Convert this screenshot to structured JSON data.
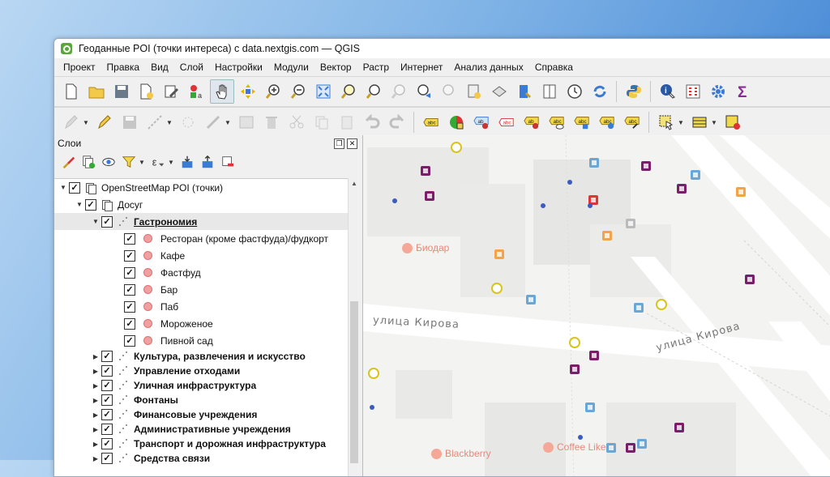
{
  "window": {
    "title": "Геоданные POI (точки интереса) с data.nextgis.com — QGIS"
  },
  "menu": [
    "Проект",
    "Правка",
    "Вид",
    "Слой",
    "Настройки",
    "Модули",
    "Вектор",
    "Растр",
    "Интернет",
    "Анализ данных",
    "Справка"
  ],
  "layers_panel": {
    "title": "Слои",
    "tree": [
      {
        "label": "OpenStreetMap POI (точки)",
        "level": 0,
        "type": "group",
        "expanded": true
      },
      {
        "label": "Досуг",
        "level": 1,
        "type": "group",
        "expanded": true
      },
      {
        "label": "Гастрономия",
        "level": 2,
        "type": "category",
        "expanded": true,
        "selected": true
      },
      {
        "label": "Ресторан (кроме фастфуда)/фудкорт",
        "level": 3,
        "type": "item"
      },
      {
        "label": "Кафе",
        "level": 3,
        "type": "item"
      },
      {
        "label": "Фастфуд",
        "level": 3,
        "type": "item"
      },
      {
        "label": "Бар",
        "level": 3,
        "type": "item"
      },
      {
        "label": "Паб",
        "level": 3,
        "type": "item"
      },
      {
        "label": "Мороженое",
        "level": 3,
        "type": "item"
      },
      {
        "label": "Пивной сад",
        "level": 3,
        "type": "item"
      },
      {
        "label": "Культура, развлечения и искусство",
        "level": 2,
        "type": "category"
      },
      {
        "label": "Управление отходами",
        "level": 2,
        "type": "category"
      },
      {
        "label": "Уличная инфраструктура",
        "level": 2,
        "type": "category"
      },
      {
        "label": "Фонтаны",
        "level": 2,
        "type": "category"
      },
      {
        "label": "Финансовые учреждения",
        "level": 2,
        "type": "category"
      },
      {
        "label": "Административные учреждения",
        "level": 2,
        "type": "category"
      },
      {
        "label": "Транспорт и дорожная инфраструктура",
        "level": 2,
        "type": "category"
      },
      {
        "label": "Средства связи",
        "level": 2,
        "type": "category"
      }
    ]
  },
  "map": {
    "street_label_1": "улица Кирова",
    "street_label_2": "улица Кирова",
    "poi_labels": [
      "Биодар",
      "Blackberry",
      "Coffee Like"
    ]
  },
  "colors": {
    "museum": "#7a1e6b",
    "service": "#6aa6d6",
    "shop": "#f2a44a",
    "cafe": "#d7c51b",
    "point": "#3a5bc0",
    "food_label": "#e48a7a"
  }
}
